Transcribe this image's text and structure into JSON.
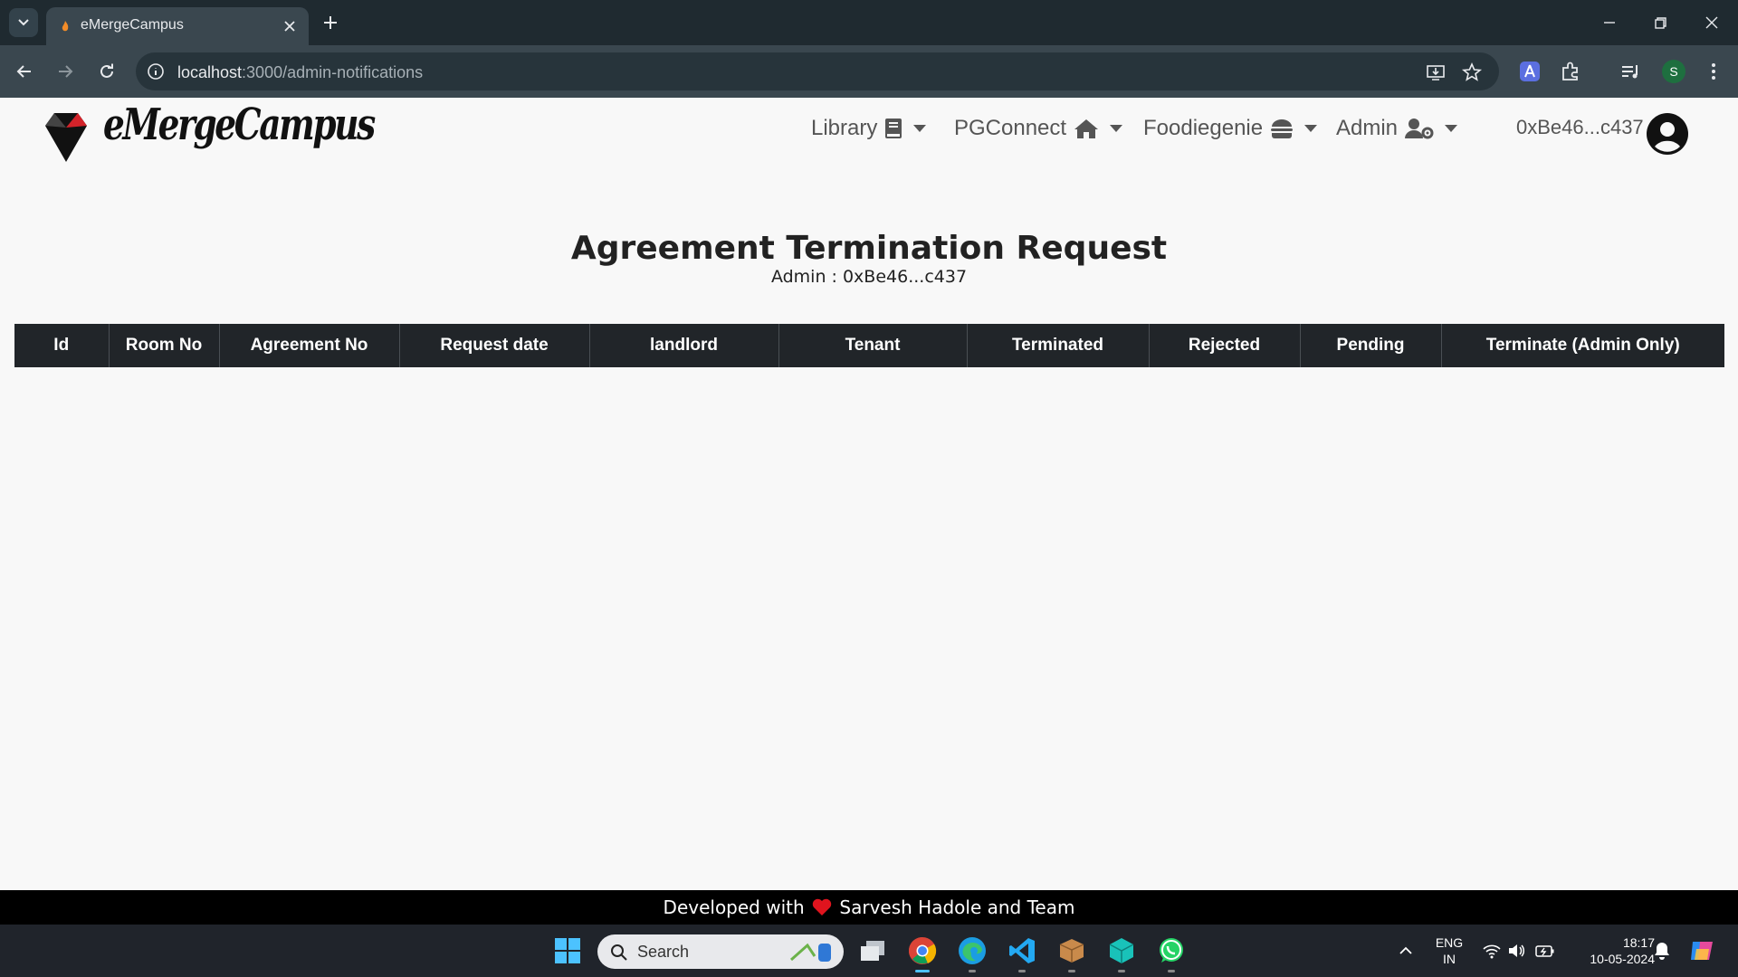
{
  "browser": {
    "tab_title": "eMergeCampus",
    "url_host": "localhost",
    "url_path": ":3000/admin-notifications",
    "profile_initial": "S"
  },
  "page": {
    "brand": "eMergeCampus",
    "nav": [
      {
        "label": "Library",
        "icon": "book-icon"
      },
      {
        "label": "PGConnect",
        "icon": "home-icon"
      },
      {
        "label": "Foodiegenie",
        "icon": "burger-icon"
      },
      {
        "label": "Admin",
        "icon": "user-gear-icon"
      }
    ],
    "account": "0xBe46...c437",
    "title": "Agreement Termination Request",
    "subtitle": "Admin : 0xBe46...c437",
    "table_headers": [
      "Id",
      "Room No",
      "Agreement No",
      "Request date",
      "landlord",
      "Tenant",
      "Terminated",
      "Rejected",
      "Pending",
      "Terminate (Admin Only)"
    ],
    "footer_prefix": "Developed with",
    "footer_suffix": "Sarvesh Hadole and Team"
  },
  "taskbar": {
    "search_label": "Search",
    "lang_line1": "ENG",
    "lang_line2": "IN",
    "time": "18:17",
    "date": "10-05-2024"
  },
  "colors": {
    "table_header": "#212529",
    "footer": "#000000",
    "heart": "#e0141e"
  }
}
